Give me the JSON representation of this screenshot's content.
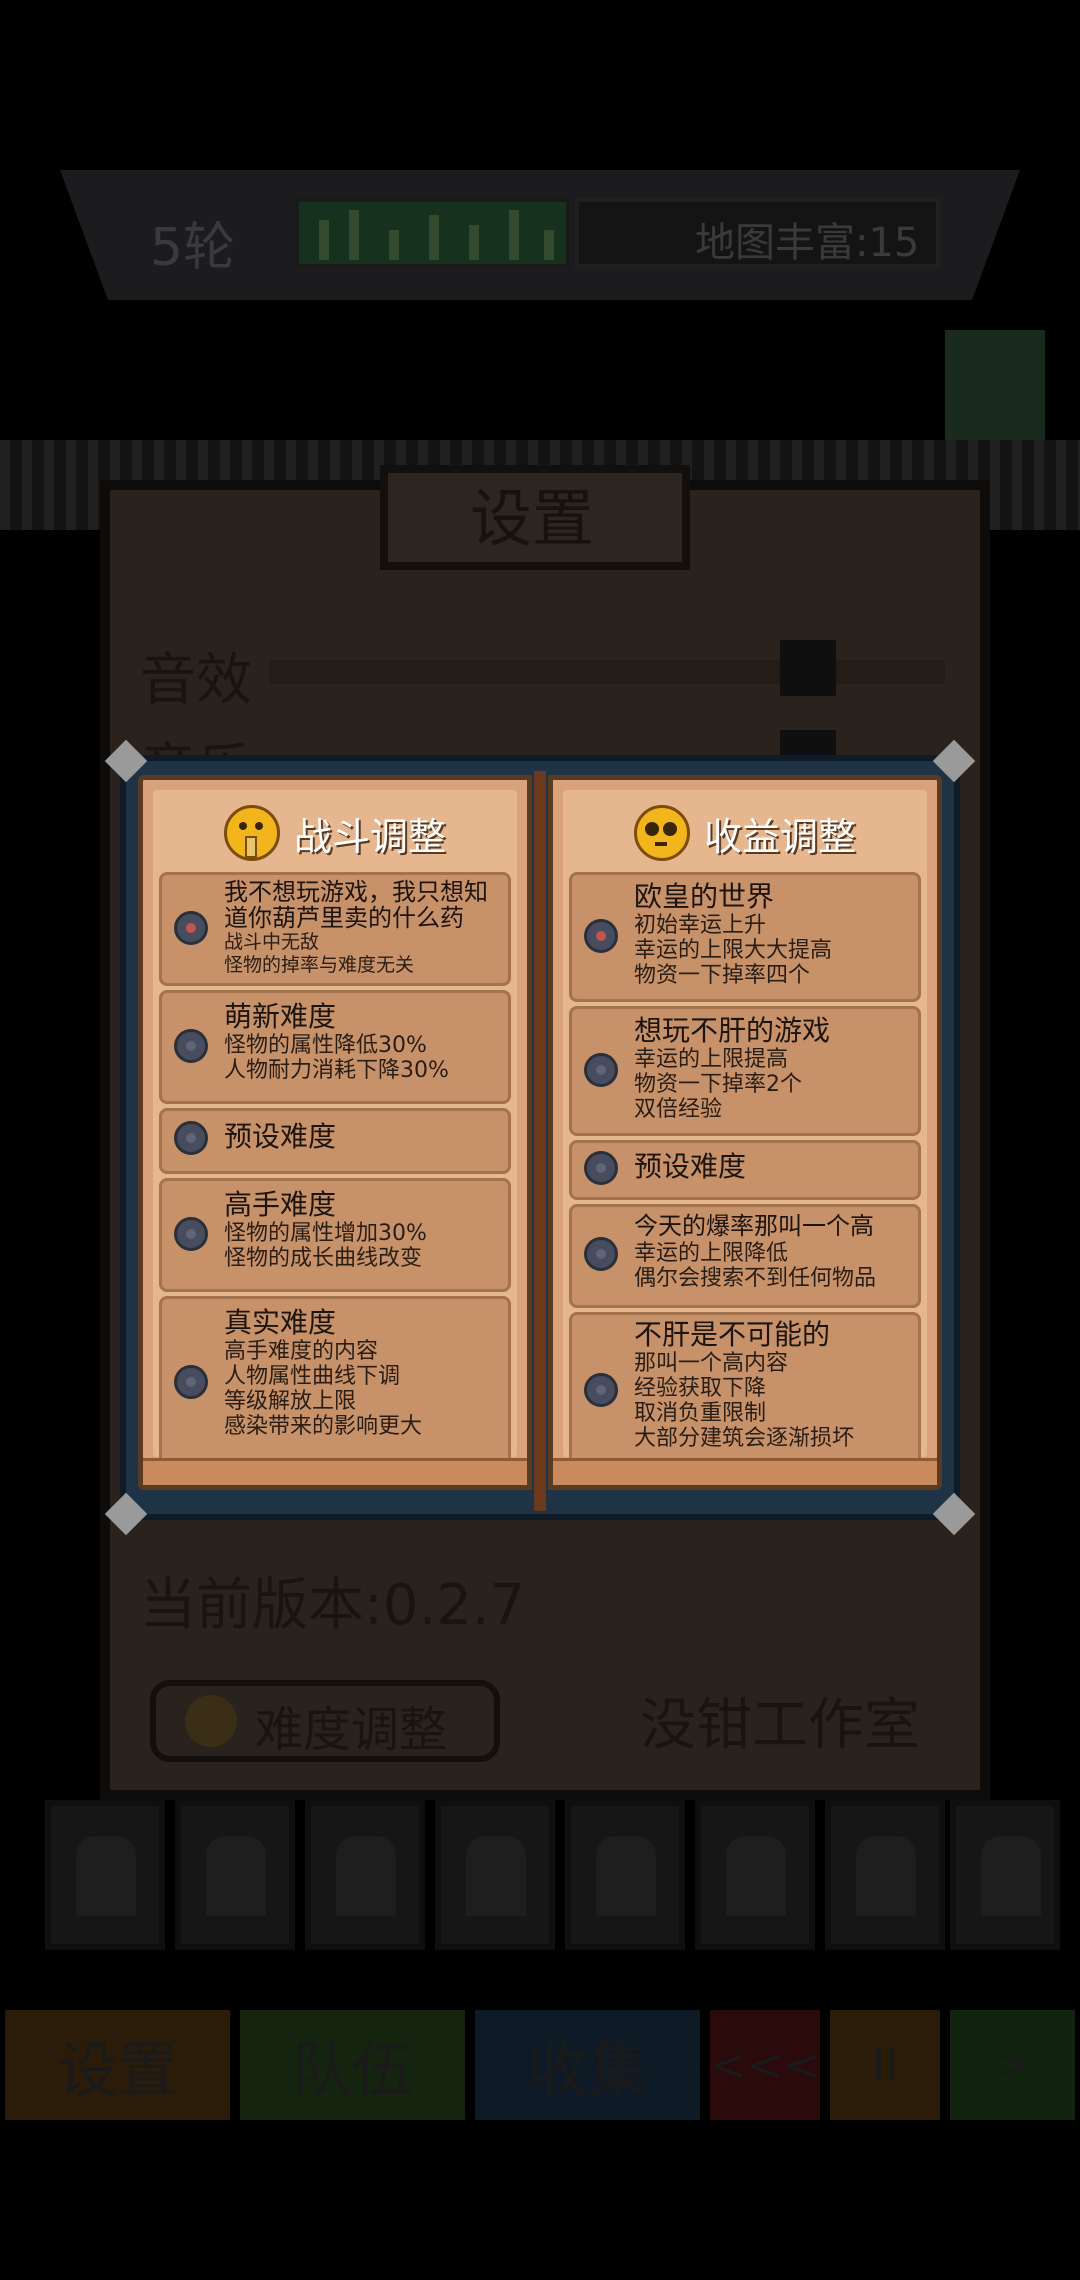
{
  "background": {
    "round_label": "5轮",
    "map_richness": "地图丰富:15",
    "settings_title": "设置",
    "sound_effects_label": "音效",
    "music_label": "音乐",
    "version": "当前版本:0.2.7",
    "difficulty_button": "难度调整",
    "studio": "没钳工作室",
    "bottom_buttons": [
      {
        "label": "设置",
        "color": "#2a1c08"
      },
      {
        "label": "队伍",
        "color": "#14240f"
      },
      {
        "label": "收集",
        "color": "#0e1a26"
      },
      {
        "label": "<<<",
        "color": "#2a0a0a"
      },
      {
        "label": "II",
        "color": "#2a1c08"
      },
      {
        "label": ">",
        "color": "#12240f"
      }
    ]
  },
  "book": {
    "left": {
      "title": "战斗调整",
      "icon": "shushing-face-icon",
      "options": [
        {
          "title": "我不想玩游戏，我只想知道你葫芦里卖的什么药",
          "desc": [
            "战斗中无敌",
            "怪物的掉率与难度无关"
          ],
          "selected": true
        },
        {
          "title": "萌新难度",
          "desc": [
            "怪物的属性降低30%",
            "人物耐力消耗下降30%"
          ],
          "selected": false
        },
        {
          "title": "预设难度",
          "desc": [],
          "selected": false
        },
        {
          "title": "高手难度",
          "desc": [
            "怪物的属性增加30%",
            "怪物的成长曲线改变"
          ],
          "selected": false
        },
        {
          "title": "真实难度",
          "desc": [
            "高手难度的内容",
            "人物属性曲线下调",
            "等级解放上限",
            "感染带来的影响更大"
          ],
          "selected": false
        }
      ]
    },
    "right": {
      "title": "收益调整",
      "icon": "pleading-face-icon",
      "options": [
        {
          "title": "欧皇的世界",
          "desc": [
            "初始幸运上升",
            "幸运的上限大大提高",
            "物资一下掉率四个"
          ],
          "selected": true
        },
        {
          "title": "想玩不肝的游戏",
          "desc": [
            "幸运的上限提高",
            "物资一下掉率2个",
            "双倍经验"
          ],
          "selected": false
        },
        {
          "title": "预设难度",
          "desc": [],
          "selected": false
        },
        {
          "title": "今天的爆率那叫一个高",
          "desc": [
            "幸运的上限降低",
            "偶尔会搜索不到任何物品"
          ],
          "selected": false
        },
        {
          "title": "不肝是不可能的",
          "desc": [
            "那叫一个高内容",
            "经验获取下降",
            "取消负重限制",
            "大部分建筑会逐渐损坏"
          ],
          "selected": false
        }
      ]
    }
  }
}
